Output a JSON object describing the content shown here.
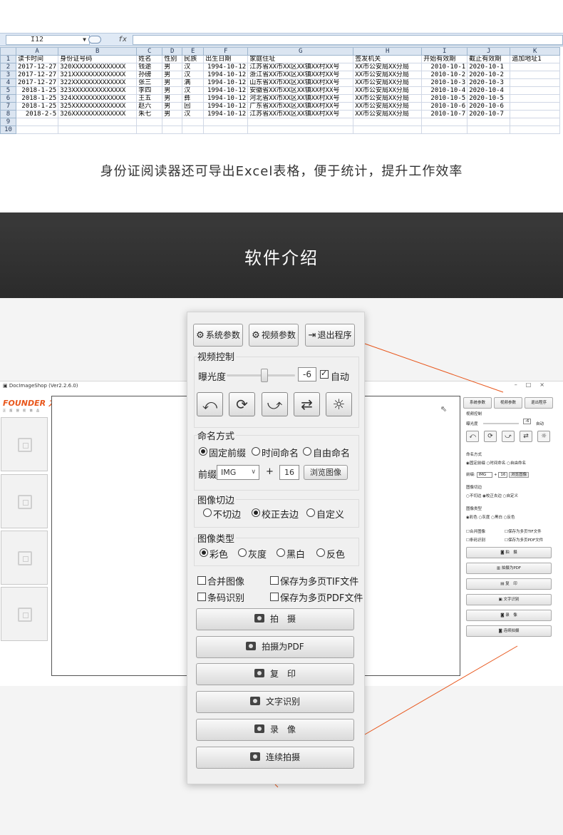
{
  "spreadsheet": {
    "namebox": "I12",
    "fx": "fx",
    "columns": [
      "A",
      "B",
      "C",
      "D",
      "E",
      "F",
      "G",
      "H",
      "I",
      "J",
      "K"
    ],
    "headers": [
      "读卡时间",
      "身份证号码",
      "姓名",
      "性别",
      "民族",
      "出生日期",
      "家庭住址",
      "签发机关",
      "开始有效期",
      "截止有效期",
      "追加地址1"
    ],
    "rows": [
      [
        "2017-12-27",
        "320XXXXXXXXXXXXXX",
        "钱途",
        "男",
        "汉",
        "1994-10-12",
        "江苏省XX市XX区XX镇XX村XX号",
        "XX市公安局XX分局",
        "2010-10-1",
        "2020-10-1",
        ""
      ],
      [
        "2017-12-27",
        "321XXXXXXXXXXXXXX",
        "孙磅",
        "男",
        "汉",
        "1994-10-12",
        "浙江省XX市XX区XX镇XX村XX号",
        "XX市公安局XX分局",
        "2010-10-2",
        "2020-10-2",
        ""
      ],
      [
        "2017-12-27",
        "322XXXXXXXXXXXXXX",
        "张三",
        "男",
        "满",
        "1994-10-12",
        "山东省XX市XX区XX镇XX村XX号",
        "XX市公安局XX分局",
        "2010-10-3",
        "2020-10-3",
        ""
      ],
      [
        "2018-1-25",
        "323XXXXXXXXXXXXXX",
        "李四",
        "男",
        "汉",
        "1994-10-12",
        "安徽省XX市XX区XX镇XX村XX号",
        "XX市公安局XX分局",
        "2010-10-4",
        "2020-10-4",
        ""
      ],
      [
        "2018-1-25",
        "324XXXXXXXXXXXXXX",
        "王五",
        "男",
        "彝",
        "1994-10-12",
        "河北省XX市XX区XX镇XX村XX号",
        "XX市公安局XX分局",
        "2010-10-5",
        "2020-10-5",
        ""
      ],
      [
        "2018-1-25",
        "325XXXXXXXXXXXXXX",
        "赵六",
        "男",
        "回",
        "1994-10-12",
        "广东省XX市XX区XX镇XX村XX号",
        "XX市公安局XX分局",
        "2010-10-6",
        "2020-10-6",
        ""
      ],
      [
        "2018-2-5",
        "326XXXXXXXXXXXXXX",
        "朱七",
        "男",
        "汉",
        "1994-10-12",
        "江苏省XX市XX区XX镇XX村XX号",
        "XX市公安局XX分局",
        "2010-10-7",
        "2020-10-7",
        ""
      ]
    ],
    "row_numbers": [
      "1",
      "2",
      "3",
      "4",
      "5",
      "6",
      "7",
      "8",
      "9",
      "10"
    ]
  },
  "caption_excel": "身份证阅读器还可导出Excel表格，便于统计，提升工作效率",
  "banner_title": "软件介绍",
  "app": {
    "window_title": "DocImageShop (Ver2.2.6.0)",
    "logo_text": "FOUNDER 方正",
    "logo_sub": "正 版 授 权 商 品"
  },
  "panel": {
    "system_params": "系统参数",
    "video_params": "视频参数",
    "exit": "退出程序",
    "video_control": "视频控制",
    "exposure_label": "曝光度",
    "exposure_value": "-6",
    "auto_label": "自动",
    "auto_checked": true,
    "naming_label": "命名方式",
    "naming_options": [
      "固定前缀",
      "时间命名",
      "自由命名"
    ],
    "naming_selected": 0,
    "prefix_label": "前缀:",
    "prefix_value": "IMG",
    "plus": "+",
    "prefix_number": "16",
    "browse_button": "浏览图像",
    "crop_label": "图像切边",
    "crop_options": [
      "不切边",
      "校正去边",
      "自定义"
    ],
    "crop_selected": 1,
    "type_label": "图像类型",
    "type_options": [
      "彩色",
      "灰度",
      "黑白",
      "反色"
    ],
    "type_selected": 0,
    "merge_images": "合并图像",
    "save_tif": "保存为多页TIF文件",
    "barcode": "条码识别",
    "save_pdf": "保存为多页PDF文件",
    "actions": [
      "拍　摄",
      "拍摄为PDF",
      "复　印",
      "文字识别",
      "录　像",
      "连续拍摄"
    ]
  },
  "colors": {
    "accent_orange": "#e8561b",
    "banner_dark": "#333333",
    "excel_header": "#dbe5f1",
    "excel_selected": "#f8d78a"
  }
}
